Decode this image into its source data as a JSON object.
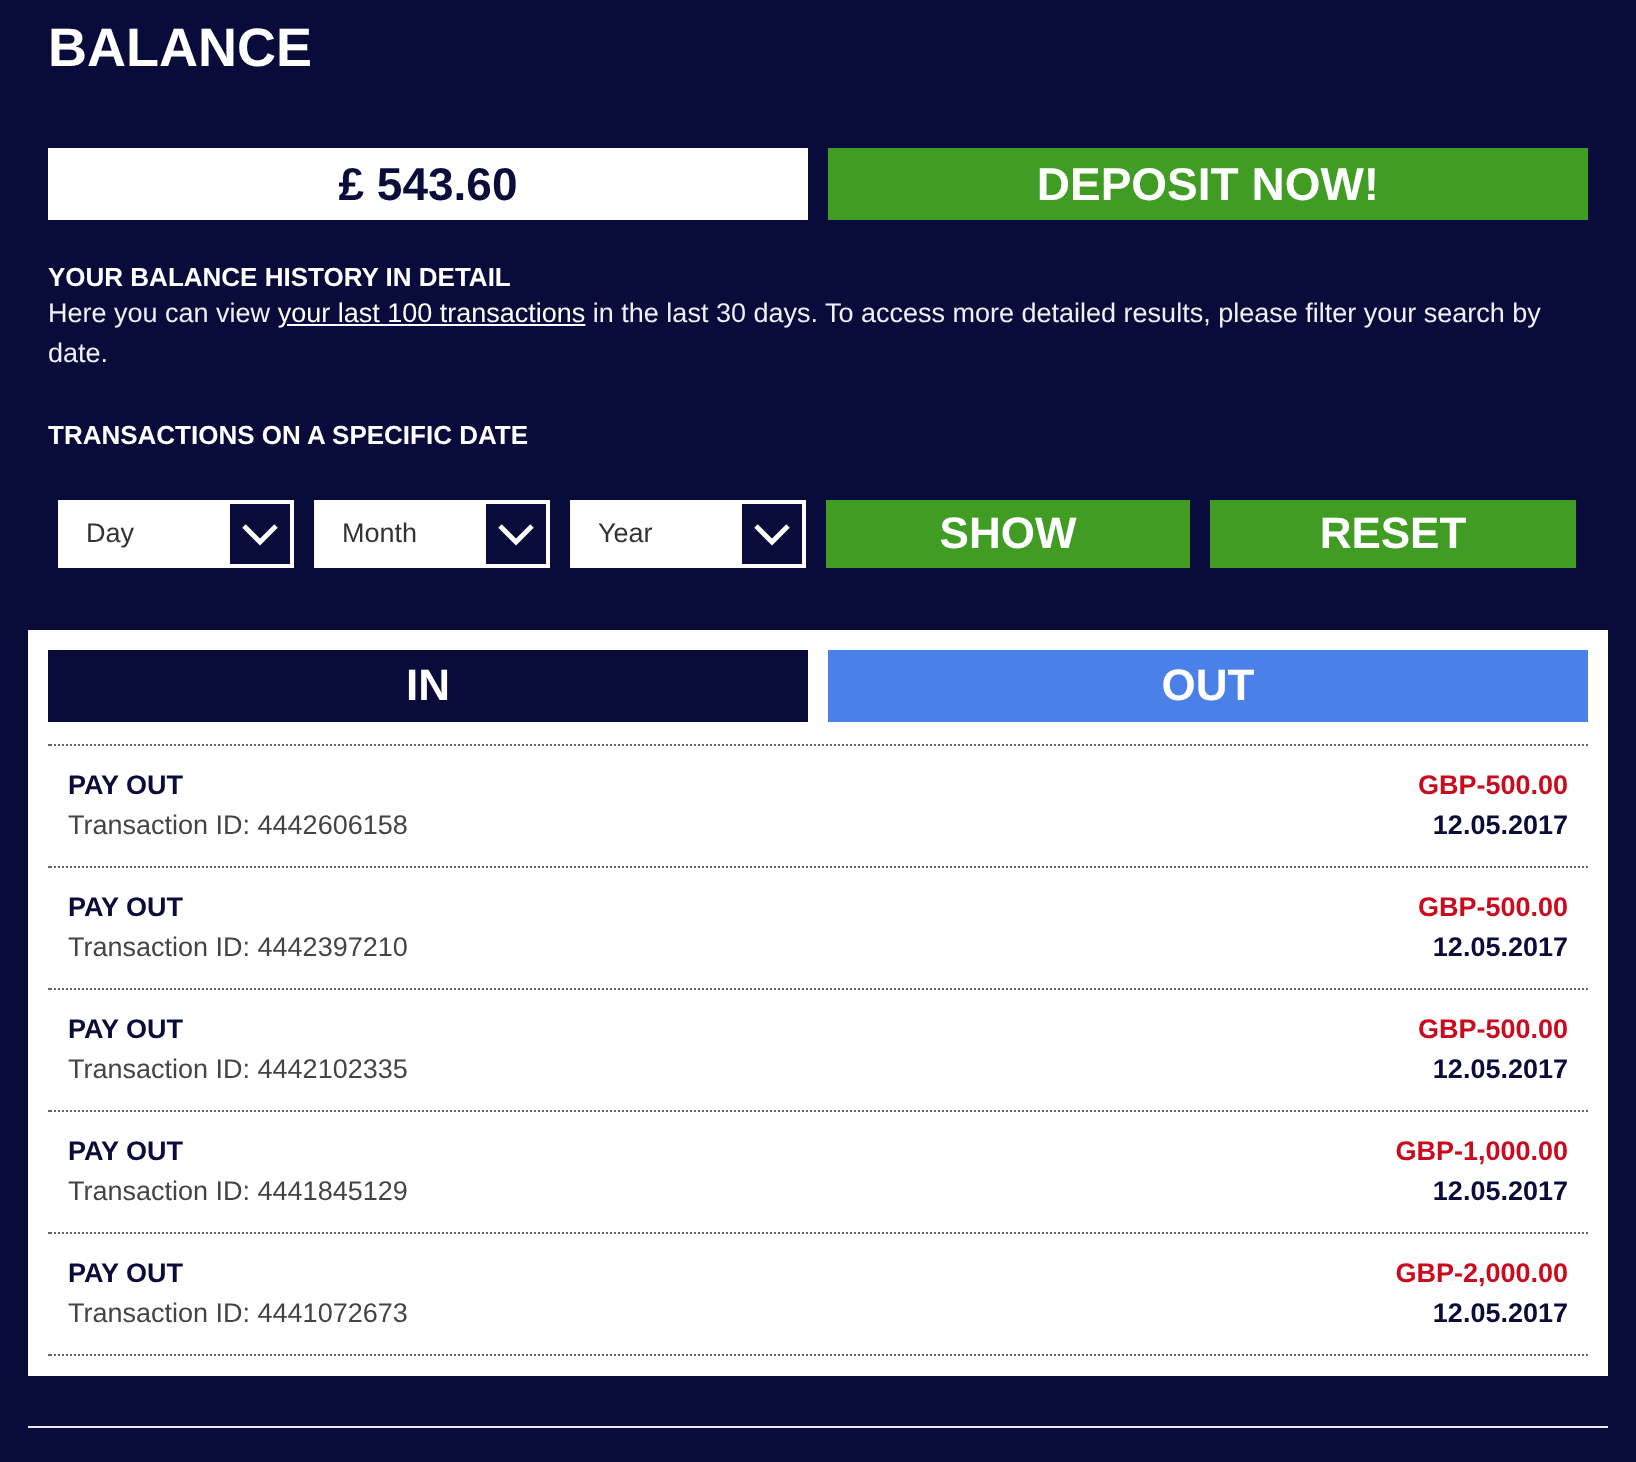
{
  "title": "BALANCE",
  "balance": {
    "amount": "£ 543.60",
    "deposit_button": "DEPOSIT NOW!"
  },
  "history": {
    "heading": "YOUR BALANCE HISTORY IN DETAIL",
    "text_before": "Here you can view ",
    "link": "your last 100 transactions",
    "text_after": " in the last 30 days. To access more detailed results, please filter your search by date."
  },
  "date_filter": {
    "heading": "TRANSACTIONS ON A SPECIFIC DATE",
    "dropdowns": [
      {
        "label": "Day"
      },
      {
        "label": "Month"
      },
      {
        "label": "Year"
      }
    ],
    "buttons": [
      "SHOW",
      "RESET"
    ]
  },
  "tabs": [
    {
      "label": "IN",
      "selected": false
    },
    {
      "label": "OUT",
      "selected": true
    }
  ],
  "transactions": [
    {
      "label": "PAY OUT",
      "transaction_id": "Transaction ID: 4442606158",
      "amount": "GBP-500.00",
      "date": "12.05.2017"
    },
    {
      "label": "PAY OUT",
      "transaction_id": "Transaction ID: 4442397210",
      "amount": "GBP-500.00",
      "date": "12.05.2017"
    },
    {
      "label": "PAY OUT",
      "transaction_id": "Transaction ID: 4442102335",
      "amount": "GBP-500.00",
      "date": "12.05.2017"
    },
    {
      "label": "PAY OUT",
      "transaction_id": "Transaction ID: 4441845129",
      "amount": "GBP-1,000.00",
      "date": "12.05.2017"
    },
    {
      "label": "PAY OUT",
      "transaction_id": "Transaction ID: 4441072673",
      "amount": "GBP-2,000.00",
      "date": "12.05.2017"
    }
  ]
}
